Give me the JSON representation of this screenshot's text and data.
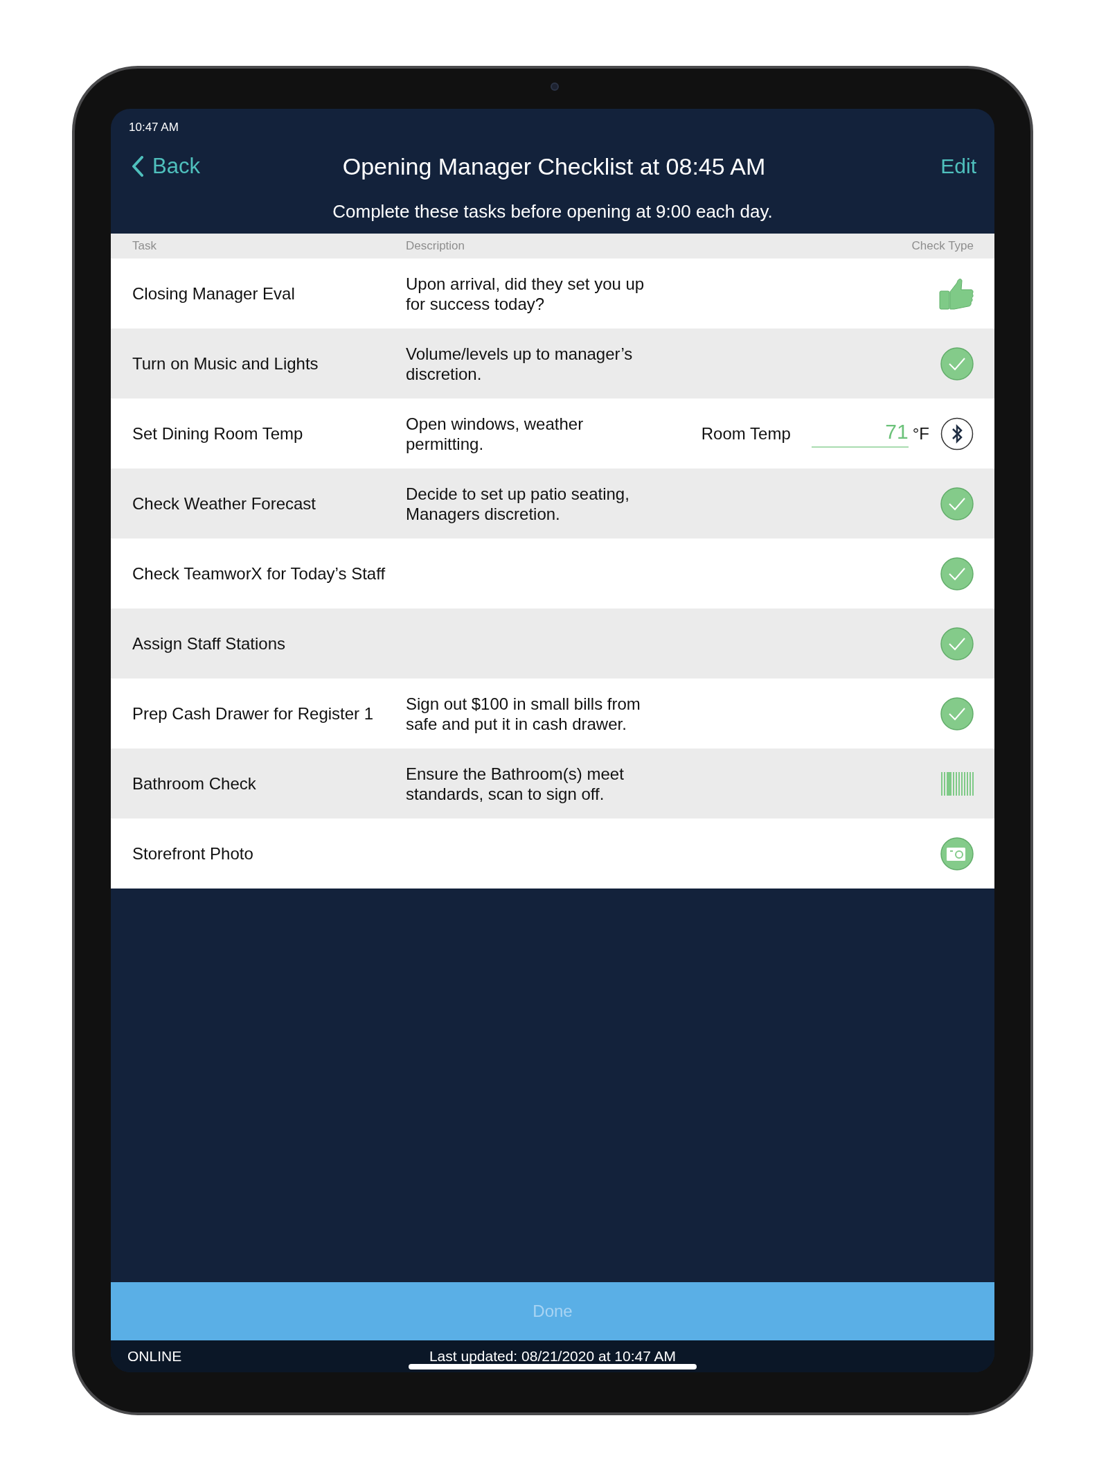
{
  "status_bar": {
    "time": "10:47 AM"
  },
  "nav": {
    "back": "Back",
    "title": "Opening Manager Checklist at 08:45 AM",
    "edit": "Edit"
  },
  "subtitle": "Complete these tasks before opening at 9:00 each day.",
  "table": {
    "columns": [
      "Task",
      "Description",
      "Check Type"
    ],
    "rows": [
      {
        "task": "Closing Manager Eval",
        "description": "Upon arrival, did they set you up for success today?",
        "check": {
          "kind": "thumbs"
        }
      },
      {
        "task": "Turn on Music and Lights",
        "description": "Volume/levels up to manager’s discretion.",
        "check": {
          "kind": "check"
        }
      },
      {
        "task": "Set Dining Room Temp",
        "description": "Open windows, weather permitting.",
        "check": {
          "kind": "temperature",
          "label": "Room Temp",
          "value": "71",
          "unit": "°F"
        }
      },
      {
        "task": "Check Weather Forecast",
        "description": "Decide to set up patio seating, Managers discretion.",
        "check": {
          "kind": "check"
        }
      },
      {
        "task": "Check TeamworX for Today’s Staff",
        "check": {
          "kind": "check"
        }
      },
      {
        "task": "Assign Staff Stations",
        "check": {
          "kind": "check"
        }
      },
      {
        "task": "Prep Cash Drawer for Register 1",
        "description": "Sign out $100 in small bills from safe and put it in cash drawer.",
        "check": {
          "kind": "check"
        }
      },
      {
        "task": "Bathroom Check",
        "description": "Ensure the Bathroom(s) meet standards, scan to sign off.",
        "check": {
          "kind": "barcode"
        }
      },
      {
        "task": "Storefront Photo",
        "check": {
          "kind": "camera"
        }
      }
    ]
  },
  "done_button": "Done",
  "footer": {
    "connection": "ONLINE",
    "last_updated": "Last updated: 08/21/2020 at 10:47 AM"
  }
}
